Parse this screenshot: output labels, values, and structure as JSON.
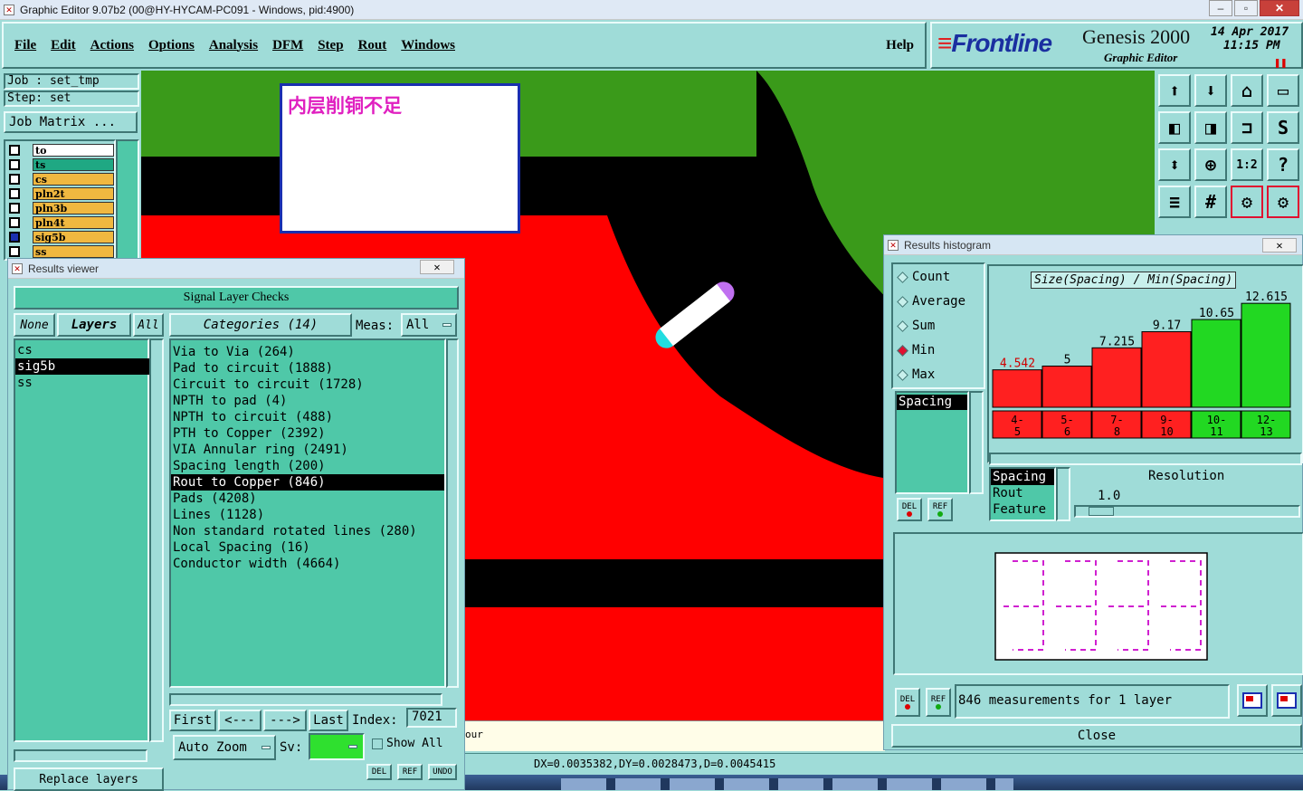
{
  "titlebar": {
    "title": "Graphic Editor 9.07b2 (00@HY-HYCAM-PC091 - Windows, pid:4900)"
  },
  "menu": {
    "items": [
      "File",
      "Edit",
      "Actions",
      "Options",
      "Analysis",
      "DFM",
      "Step",
      "Rout",
      "Windows"
    ],
    "help": "Help"
  },
  "brand": {
    "logo": "Frontline",
    "product": "Genesis 2000",
    "subtitle": "Graphic Editor",
    "date": "14 Apr 2017",
    "time": "11:15 PM"
  },
  "job": {
    "job_label": "Job : set_tmp",
    "step_label": "Step: set",
    "matrix_button": "Job Matrix ..."
  },
  "layers": [
    {
      "name": "to",
      "color": "#ffffff"
    },
    {
      "name": "ts",
      "color": "#1fa883"
    },
    {
      "name": "cs",
      "color": "#f0b840"
    },
    {
      "name": "pln2t",
      "color": "#f0b840"
    },
    {
      "name": "pln3b",
      "color": "#f0b840"
    },
    {
      "name": "pln4t",
      "color": "#f0b840"
    },
    {
      "name": "sig5b",
      "color": "#f0b840"
    },
    {
      "name": "ss",
      "color": "#f0b840"
    }
  ],
  "annotation": {
    "text": "内层削铜不足"
  },
  "results_viewer": {
    "title": "Results viewer",
    "header": "Signal Layer Checks",
    "none_btn": "None",
    "layers_btn": "Layers",
    "all_btn": "All",
    "layer_list": [
      "cs",
      "sig5b",
      "ss"
    ],
    "categories_label": "Categories (14)",
    "meas_label": "Meas:",
    "meas_value": "All",
    "categories": [
      "Via to Via (264)",
      "Pad to circuit (1888)",
      "Circuit to circuit (1728)",
      "NPTH to pad (4)",
      "NPTH to circuit (488)",
      "PTH to Copper (2392)",
      "VIA Annular ring (2491)",
      "Spacing length (200)",
      "Rout to Copper (846)",
      "Pads (4208)",
      "Lines (1128)",
      "Non standard rotated lines (280)",
      "Local Spacing (16)",
      "Conductor width (4664)"
    ],
    "selected_category": "Rout to Copper (846)",
    "first": "First",
    "prev": "<---",
    "next": "--->",
    "last": "Last",
    "index_label": "Index:",
    "index_value": "7021",
    "auto_zoom": "Auto Zoom",
    "sv_label": "Sv:",
    "show_all": "Show All",
    "replace_layers": "Replace layers",
    "del": "DEL",
    "ref": "REF",
    "undo": "UNDO"
  },
  "status": {
    "coords": "DX=0.0035382,DY=0.0028473,D=0.0045415",
    "partial": "our"
  },
  "histogram": {
    "title": "Results histogram",
    "modes": [
      "Count",
      "Average",
      "Sum",
      "Min",
      "Max"
    ],
    "selected_mode": "Min",
    "measure_list": [
      "Spacing"
    ],
    "chart_title": "Size(Spacing) / Min(Spacing)",
    "axis_list": [
      "Spacing",
      "Rout",
      "Feature"
    ],
    "resolution_label": "Resolution",
    "resolution_value": "1.0",
    "summary": "846 measurements for 1 layer",
    "close": "Close",
    "del": "DEL",
    "ref": "REF"
  },
  "chart_data": {
    "type": "bar",
    "title": "Size(Spacing) / Min(Spacing)",
    "categories": [
      "4-5",
      "5-6",
      "7-8",
      "9-10",
      "10-11",
      "12-13"
    ],
    "values": [
      4.542,
      5,
      7.215,
      9.17,
      10.65,
      12.615
    ],
    "value_labels": [
      "4.542",
      "5",
      "7.215",
      "9.17",
      "10.65",
      "12.615"
    ],
    "bar_colors": [
      "#ff2020",
      "#ff2020",
      "#ff2020",
      "#ff2020",
      "#22d822",
      "#22d822"
    ],
    "label_colors": [
      "#d00000",
      "#000000",
      "#000000",
      "#000000",
      "#000000",
      "#000000"
    ],
    "ylim": [
      0,
      14
    ],
    "grid": false
  },
  "colors": {
    "canvas_red": "#ff0000",
    "canvas_green": "#3a9a1a",
    "canvas_black": "#000000",
    "panel": "#9fdcd8",
    "teal": "#4fc8a8"
  }
}
